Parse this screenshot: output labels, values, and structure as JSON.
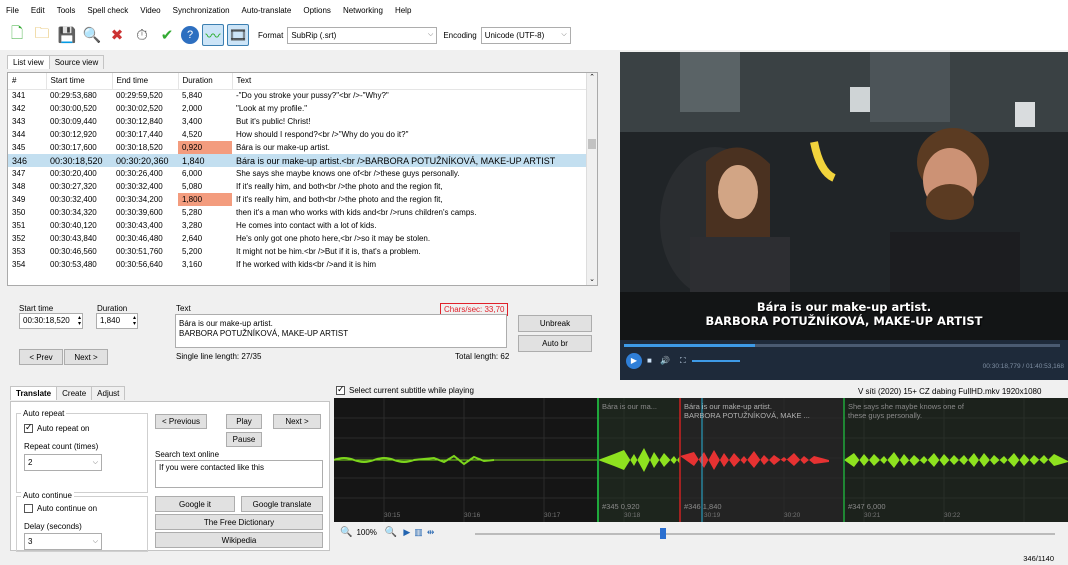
{
  "menu": [
    "File",
    "Edit",
    "Tools",
    "Spell check",
    "Video",
    "Synchronization",
    "Auto-translate",
    "Options",
    "Networking",
    "Help"
  ],
  "toolbar": {
    "format_label": "Format",
    "format_value": "SubRip (.srt)",
    "encoding_label": "Encoding",
    "encoding_value": "Unicode (UTF-8)"
  },
  "view_tabs": [
    "List view",
    "Source view"
  ],
  "grid": {
    "headers": [
      "#",
      "Start time",
      "End time",
      "Duration",
      "Text"
    ],
    "rows": [
      {
        "n": "341",
        "start": "00:29:53,680",
        "end": "00:29:59,520",
        "dur": "5,840",
        "text": "-\"Do you stroke your pussy?\"<br />-\"Why?\""
      },
      {
        "n": "342",
        "start": "00:30:00,520",
        "end": "00:30:02,520",
        "dur": "2,000",
        "text": "\"Look at my profile.\""
      },
      {
        "n": "343",
        "start": "00:30:09,440",
        "end": "00:30:12,840",
        "dur": "3,400",
        "text": "But it's public! Christ!"
      },
      {
        "n": "344",
        "start": "00:30:12,920",
        "end": "00:30:17,440",
        "dur": "4,520",
        "text": "How should I respond?<br />\"Why do you do it?\""
      },
      {
        "n": "345",
        "start": "00:30:17,600",
        "end": "00:30:18,520",
        "dur": "0,920",
        "text": "Bára is our make-up artist.",
        "warn": true
      },
      {
        "n": "346",
        "start": "00:30:18,520",
        "end": "00:30:20,360",
        "dur": "1,840",
        "text": "Bára is our make-up artist.<br />BARBORA POTUŽNÍKOVÁ, MAKE-UP ARTIST",
        "selected": true
      },
      {
        "n": "347",
        "start": "00:30:20,400",
        "end": "00:30:26,400",
        "dur": "6,000",
        "text": "She says she maybe knows one of<br />these guys personally."
      },
      {
        "n": "348",
        "start": "00:30:27,320",
        "end": "00:30:32,400",
        "dur": "5,080",
        "text": "If it's really him, and both<br />the photo and the region fit,"
      },
      {
        "n": "349",
        "start": "00:30:32,400",
        "end": "00:30:34,200",
        "dur": "1,800",
        "text": "If it's really him, and both<br />the photo and the region fit,",
        "warn": true
      },
      {
        "n": "350",
        "start": "00:30:34,320",
        "end": "00:30:39,600",
        "dur": "5,280",
        "text": "then it's a man who works with kids and<br />runs children's camps."
      },
      {
        "n": "351",
        "start": "00:30:40,120",
        "end": "00:30:43,400",
        "dur": "3,280",
        "text": "He comes into contact with a lot of kids."
      },
      {
        "n": "352",
        "start": "00:30:43,840",
        "end": "00:30:46,480",
        "dur": "2,640",
        "text": "He's only got one photo here,<br />so it may be stolen."
      },
      {
        "n": "353",
        "start": "00:30:46,560",
        "end": "00:30:51,760",
        "dur": "5,200",
        "text": "It might not be him.<br />But if it is, that's a problem."
      },
      {
        "n": "354",
        "start": "00:30:53,480",
        "end": "00:30:56,640",
        "dur": "3,160",
        "text": "If he worked with kids<br />and it is him"
      }
    ]
  },
  "editor": {
    "start_label": "Start time",
    "duration_label": "Duration",
    "text_label": "Text",
    "start_value": "00:30:18,520",
    "duration_value": "1,840",
    "chars_sec": "Chars/sec: 33,70",
    "line1": "Bára is our make-up artist.",
    "line2": "BARBORA POTUŽNÍKOVÁ, MAKE-UP ARTIST",
    "unbreak": "Unbreak",
    "auto_br": "Auto br",
    "prev": "< Prev",
    "next": "Next >",
    "single_line": "Single line length: 27/35",
    "total_length": "Total length: 62"
  },
  "video": {
    "subtitle1": "Bára is our make-up artist.",
    "subtitle2": "BARBORA POTUŽNÍKOVÁ, MAKE-UP ARTIST",
    "time": "00:30:18,779 / 01:40:53,168",
    "progress": 0.3
  },
  "bottom_tabs": [
    "Translate",
    "Create",
    "Adjust"
  ],
  "translate": {
    "auto_repeat_group": "Auto repeat",
    "auto_repeat_on": "Auto repeat on",
    "repeat_count_label": "Repeat count (times)",
    "repeat_count": "2",
    "auto_continue_group": "Auto continue",
    "auto_continue_on": "Auto continue on",
    "delay_label": "Delay (seconds)",
    "delay": "3",
    "previous": "< Previous",
    "play": "Play",
    "next": "Next >",
    "pause": "Pause",
    "search_label": "Search text online",
    "search_text": "If you were contacted like this",
    "google_it": "Google it",
    "google_translate": "Google translate",
    "free_dictionary": "The Free Dictionary",
    "wikipedia": "Wikipedia"
  },
  "waveform": {
    "select_label": "Select current subtitle while playing",
    "file_info": "V síti (2020) 15+ CZ dabing FullHD.mkv 1920x1080",
    "seg1_text": "Bára is our ma...",
    "seg2_text1": "Bára is our make-up artist.",
    "seg2_text2": "BARBORA POTUŽNÍKOVÁ, MAKE ...",
    "seg3_text1": "She says she maybe knows one of",
    "seg3_text2": "these guys personally.",
    "seg1_info": "#345 0,920",
    "seg2_info": "#346 1,840",
    "seg3_info": "#347 6,000",
    "ticks": [
      "30:15",
      "30:16",
      "30:17",
      "30:18",
      "30:19",
      "30:20",
      "30:21",
      "30:22"
    ],
    "zoom": "100%"
  },
  "status": "346/1140"
}
